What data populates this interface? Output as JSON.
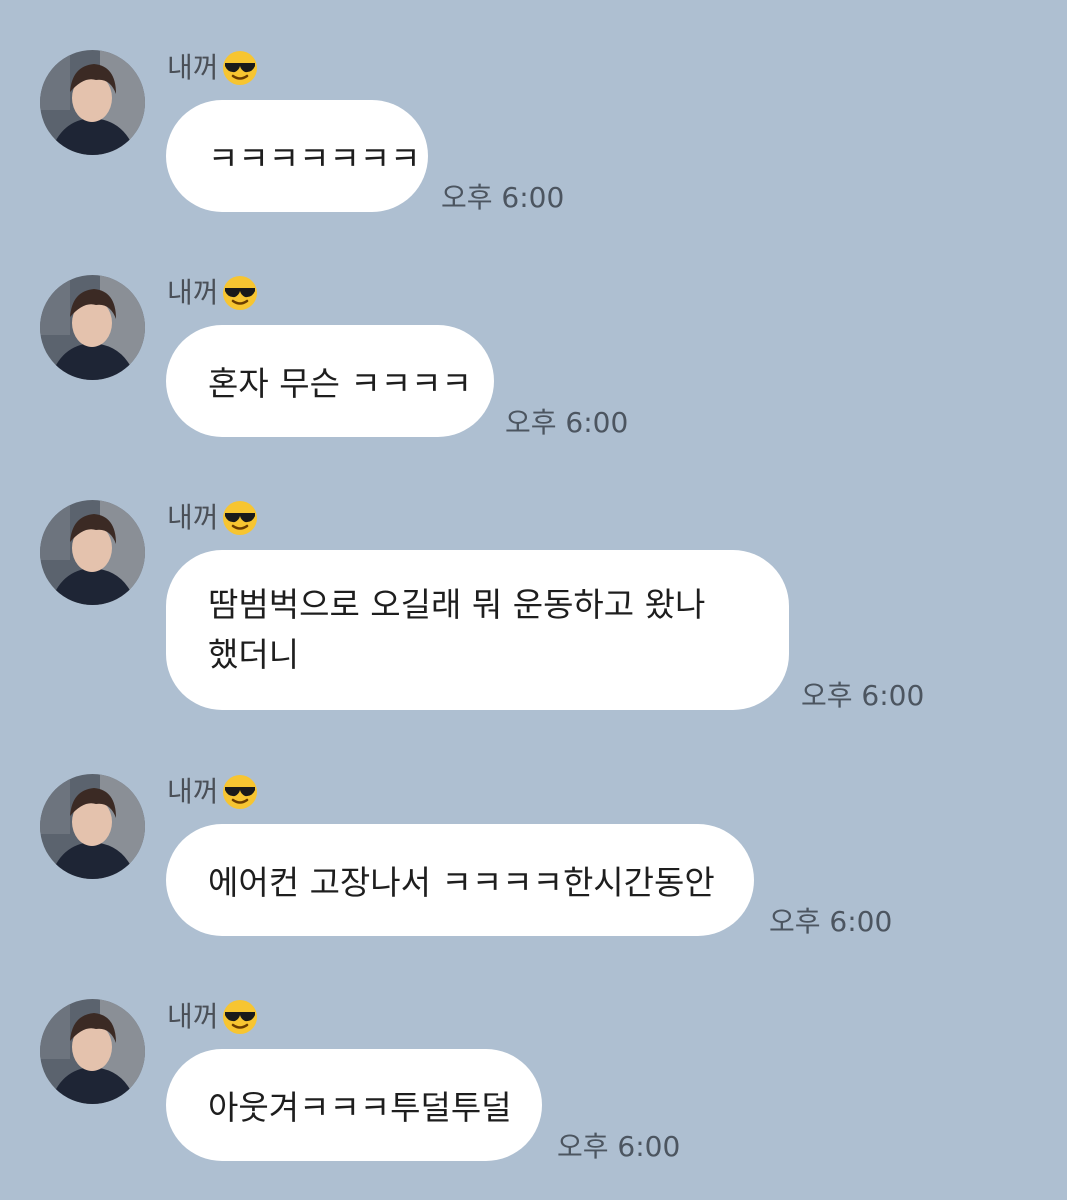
{
  "chat": {
    "messages": [
      {
        "sender": "내꺼",
        "sender_emoji": "smiling-face-with-sunglasses",
        "text": "ㅋㅋㅋㅋㅋㅋㅋ",
        "time": "오후 6:00"
      },
      {
        "sender": "내꺼",
        "sender_emoji": "smiling-face-with-sunglasses",
        "text": "혼자 무슨 ㅋㅋㅋㅋ",
        "time": "오후 6:00"
      },
      {
        "sender": "내꺼",
        "sender_emoji": "smiling-face-with-sunglasses",
        "text": "땀범벅으로 오길래 뭐 운동하고 왔나 했더니",
        "time": "오후 6:00"
      },
      {
        "sender": "내꺼",
        "sender_emoji": "smiling-face-with-sunglasses",
        "text": "에어컨 고장나서 ㅋㅋㅋㅋ한시간동안",
        "time": "오후 6:00"
      },
      {
        "sender": "내꺼",
        "sender_emoji": "smiling-face-with-sunglasses",
        "text": "아웃겨ㅋㅋㅋ투덜투덜",
        "time": "오후 6:00"
      }
    ]
  },
  "colors": {
    "background": "#aebfd1",
    "bubble": "#ffffff",
    "text": "#1e1e1e",
    "timestamp": "#4c5560"
  }
}
